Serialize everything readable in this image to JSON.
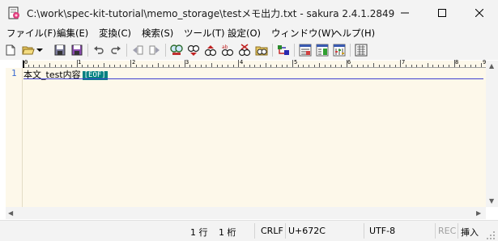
{
  "window": {
    "title": "C:\\work\\spec-kit-tutorial\\memo_storage\\testメモ出力.txt - sakura 2.4.1.2849",
    "app_icon": "sakura-editor-icon",
    "controls": {
      "minimize_icon": "minimize-icon",
      "maximize_icon": "maximize-icon",
      "close_icon": "close-icon"
    }
  },
  "menu": [
    {
      "label": "ファイル(F)"
    },
    {
      "label": "編集(E)"
    },
    {
      "label": "変換(C)"
    },
    {
      "label": "検索(S)"
    },
    {
      "label": "ツール(T)"
    },
    {
      "label": "設定(O)"
    },
    {
      "label": "ウィンドウ(W)"
    },
    {
      "label": "ヘルプ(H)"
    }
  ],
  "toolbar": [
    {
      "icon": "new-file-icon"
    },
    {
      "icon": "open-folder-icon"
    },
    {
      "icon": "dropdown-icon"
    },
    {
      "icon": "save-icon"
    },
    {
      "icon": "save-all-icon"
    },
    {
      "icon": "undo-icon"
    },
    {
      "icon": "redo-icon"
    },
    {
      "icon": "jump-back-icon"
    },
    {
      "icon": "jump-forward-icon"
    },
    {
      "icon": "search-icon"
    },
    {
      "icon": "search-prev-icon"
    },
    {
      "icon": "search-next-icon"
    },
    {
      "icon": "replace-icon"
    },
    {
      "icon": "clear-mark-icon"
    },
    {
      "icon": "grep-icon"
    },
    {
      "icon": "outline-icon"
    },
    {
      "icon": "tag-jump-icon"
    },
    {
      "icon": "compare-icon"
    },
    {
      "icon": "settings-icon"
    },
    {
      "icon": "font-icon"
    }
  ],
  "ruler": {
    "labels": [
      "0",
      "1",
      "2",
      "3",
      "4",
      "5",
      "6",
      "7",
      "8",
      "9"
    ]
  },
  "editor": {
    "lines": [
      {
        "number": "1",
        "text": "本文_test内容",
        "eof": "[EOF]"
      }
    ],
    "background": "#fdf8ea",
    "eof_color": "#008080"
  },
  "status": {
    "line": "1 行",
    "column": "1 桁",
    "newline": "CRLF",
    "codepoint": "U+672C",
    "encoding": "UTF-8",
    "rec": "REC",
    "mode": "挿入"
  }
}
